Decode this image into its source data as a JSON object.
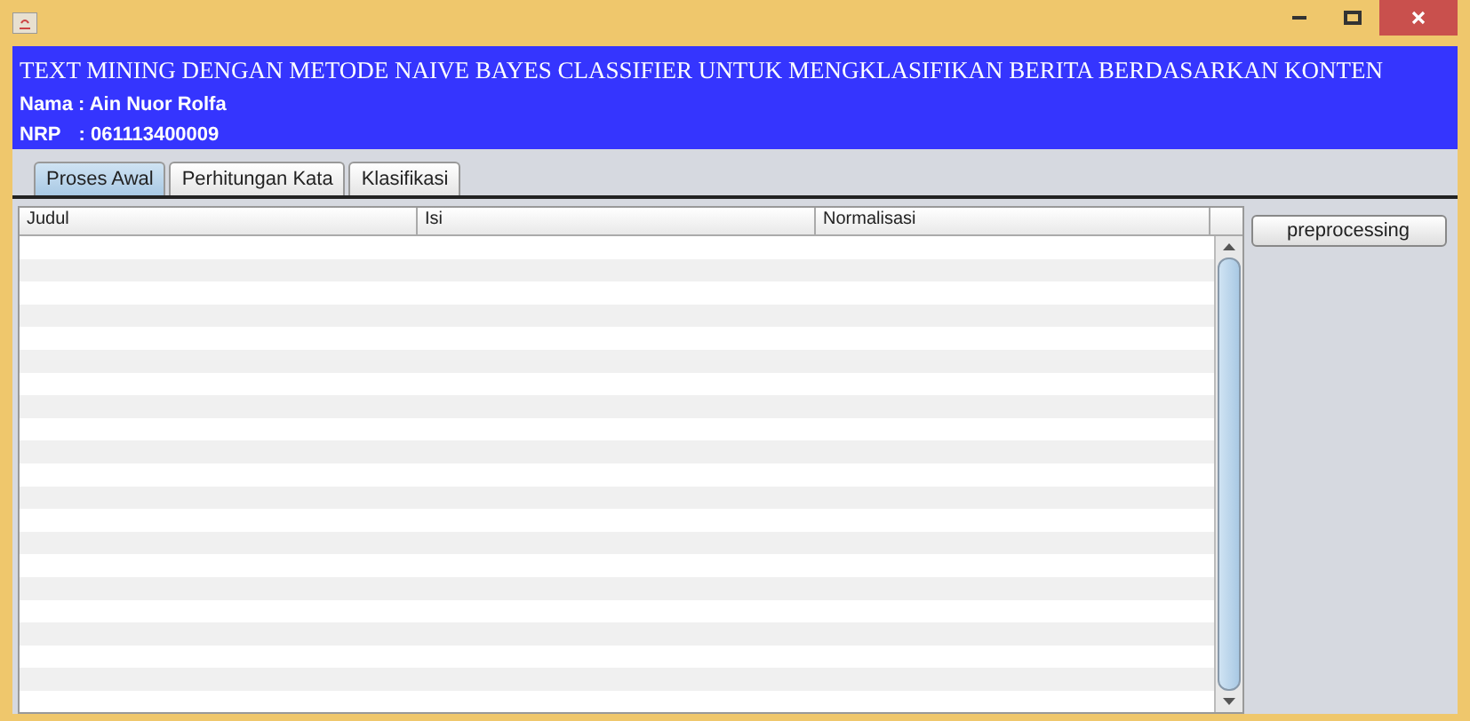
{
  "header": {
    "title": "TEXT MINING DENGAN METODE NAIVE BAYES CLASSIFIER UNTUK MENGKLASIFIKAN BERITA BERDASARKAN KONTEN",
    "name_line": "Nama : Ain Nuor Rolfa",
    "nrp_label": "NRP",
    "nrp_value": ": 061113400009"
  },
  "tabs": [
    {
      "label": "Proses Awal",
      "selected": true
    },
    {
      "label": "Perhitungan Kata",
      "selected": false
    },
    {
      "label": "Klasifikasi",
      "selected": false
    }
  ],
  "table": {
    "columns": [
      "Judul",
      "Isi",
      "Normalisasi"
    ]
  },
  "buttons": [
    "preprocessing"
  ]
}
